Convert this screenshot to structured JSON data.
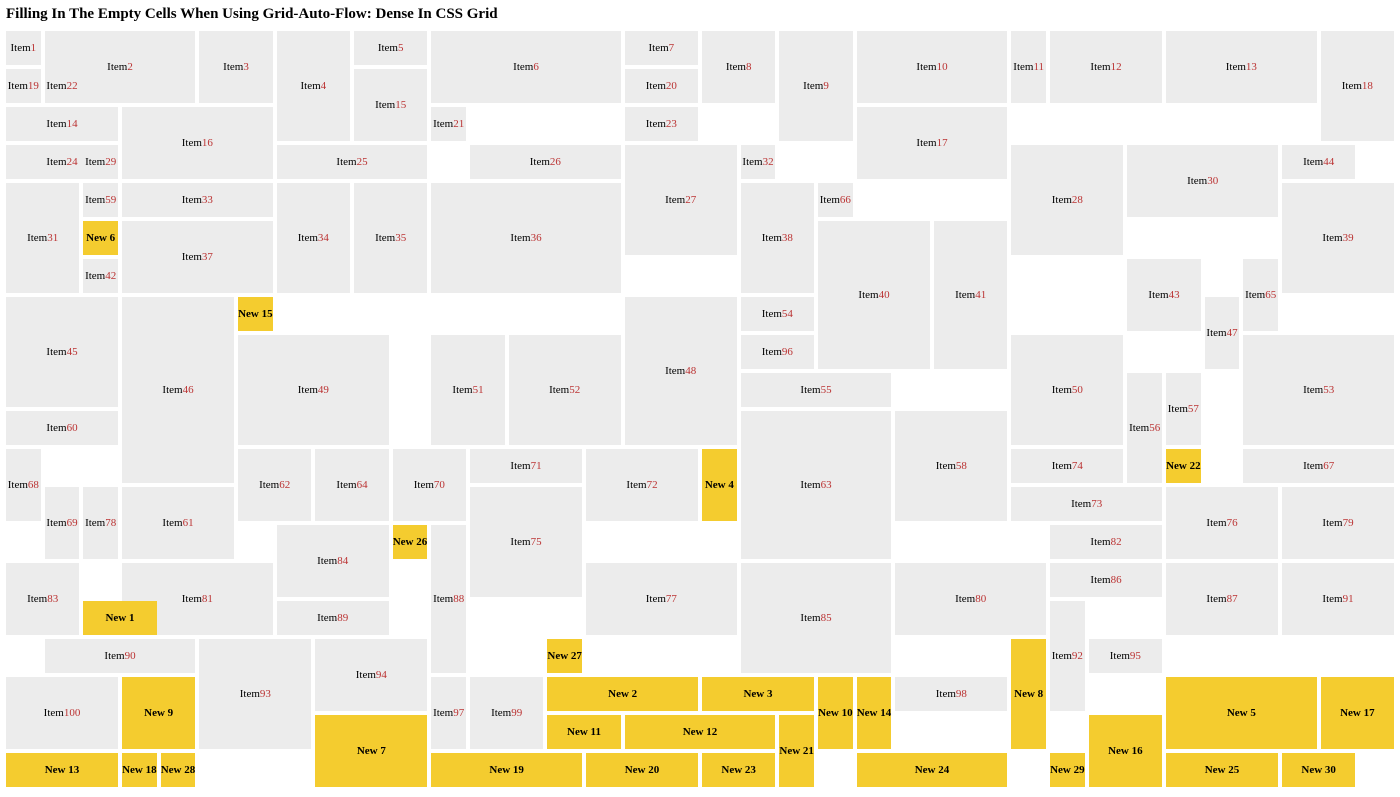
{
  "title": "Filling In The Empty Cells When Using Grid-Auto-Flow: Dense In CSS Grid",
  "base_prefix": "Item ",
  "new_prefix": "New ",
  "base_items": [
    {
      "label": "Item 1",
      "c": 1,
      "r": 1,
      "cs": 1,
      "rs": 1
    },
    {
      "label": "Item 2",
      "c": 2,
      "r": 1,
      "cs": 4,
      "rs": 2
    },
    {
      "label": "Item 3",
      "c": 6,
      "r": 1,
      "cs": 2,
      "rs": 2
    },
    {
      "label": "Item 4",
      "c": 8,
      "r": 1,
      "cs": 2,
      "rs": 3
    },
    {
      "label": "Item 5",
      "c": 10,
      "r": 1,
      "cs": 2,
      "rs": 1
    },
    {
      "label": "Item 6",
      "c": 12,
      "r": 1,
      "cs": 5,
      "rs": 2
    },
    {
      "label": "Item 7",
      "c": 17,
      "r": 1,
      "cs": 2,
      "rs": 1
    },
    {
      "label": "Item 8",
      "c": 19,
      "r": 1,
      "cs": 2,
      "rs": 2
    },
    {
      "label": "Item 9",
      "c": 21,
      "r": 1,
      "cs": 2,
      "rs": 3
    },
    {
      "label": "Item 10",
      "c": 23,
      "r": 1,
      "cs": 4,
      "rs": 2
    },
    {
      "label": "Item 11",
      "c": 27,
      "r": 1,
      "cs": 1,
      "rs": 2
    },
    {
      "label": "Item 12",
      "c": 28,
      "r": 1,
      "cs": 3,
      "rs": 2
    },
    {
      "label": "Item 13",
      "c": 31,
      "r": 1,
      "cs": 4,
      "rs": 2
    },
    {
      "label": "Item 18",
      "c": 35,
      "r": 1,
      "cs": 2,
      "rs": 3
    },
    {
      "label": "Item 19",
      "c": 1,
      "r": 2,
      "cs": 1,
      "rs": 1
    },
    {
      "label": "Item 14",
      "c": 1,
      "r": 3,
      "cs": 3,
      "rs": 1
    },
    {
      "label": "Item 16",
      "c": 4,
      "r": 3,
      "cs": 4,
      "rs": 2
    },
    {
      "label": "Item 15",
      "c": 10,
      "r": 2,
      "cs": 2,
      "rs": 2
    },
    {
      "label": "Item 21",
      "c": 12,
      "r": 3,
      "cs": 1,
      "rs": 1
    },
    {
      "label": "Item 20",
      "c": 17,
      "r": 2,
      "cs": 2,
      "rs": 1
    },
    {
      "label": "Item 23",
      "c": 17,
      "r": 3,
      "cs": 2,
      "rs": 1
    },
    {
      "label": "Item 17",
      "c": 23,
      "r": 3,
      "cs": 4,
      "rs": 2
    },
    {
      "label": "Item 24",
      "c": 1,
      "r": 4,
      "cs": 3,
      "rs": 1
    },
    {
      "label": "Item 25",
      "c": 8,
      "r": 4,
      "cs": 4,
      "rs": 1
    },
    {
      "label": "Item 26",
      "c": 13,
      "r": 4,
      "cs": 4,
      "rs": 1
    },
    {
      "label": "Item 27",
      "c": 17,
      "r": 4,
      "cs": 3,
      "rs": 3
    },
    {
      "label": "Item 32",
      "c": 20,
      "r": 4,
      "cs": 1,
      "rs": 1
    },
    {
      "label": "Item 28",
      "c": 27,
      "r": 4,
      "cs": 3,
      "rs": 3
    },
    {
      "label": "Item 30",
      "c": 30,
      "r": 4,
      "cs": 4,
      "rs": 2
    },
    {
      "label": "Item 44",
      "c": 34,
      "r": 4,
      "cs": 2,
      "rs": 1
    },
    {
      "label": "Item 31",
      "c": 1,
      "r": 5,
      "cs": 2,
      "rs": 3
    },
    {
      "label": "Item 59",
      "c": 3,
      "r": 5,
      "cs": 1,
      "rs": 1
    },
    {
      "label": "Item 29",
      "c": 3,
      "r": 4,
      "cs": 1,
      "rs": 1
    },
    {
      "label": "Item 33",
      "c": 4,
      "r": 5,
      "cs": 4,
      "rs": 1
    },
    {
      "label": "Item 66",
      "c": 22,
      "r": 5,
      "cs": 1,
      "rs": 1
    },
    {
      "label": "Item 37",
      "c": 4,
      "r": 6,
      "cs": 4,
      "rs": 2
    },
    {
      "label": "Item 34",
      "c": 8,
      "r": 5,
      "cs": 2,
      "rs": 3
    },
    {
      "label": "Item 35",
      "c": 10,
      "r": 5,
      "cs": 2,
      "rs": 3
    },
    {
      "label": "Item 36",
      "c": 12,
      "r": 5,
      "cs": 5,
      "rs": 3
    },
    {
      "label": "Item 38",
      "c": 20,
      "r": 5,
      "cs": 2,
      "rs": 3
    },
    {
      "label": "Item 40",
      "c": 22,
      "r": 6,
      "cs": 3,
      "rs": 4
    },
    {
      "label": "Item 41",
      "c": 25,
      "r": 6,
      "cs": 2,
      "rs": 4
    },
    {
      "label": "Item 39",
      "c": 34,
      "r": 5,
      "cs": 3,
      "rs": 3
    },
    {
      "label": "Item 42",
      "c": 3,
      "r": 7,
      "cs": 1,
      "rs": 1
    },
    {
      "label": "Item 43",
      "c": 30,
      "r": 7,
      "cs": 2,
      "rs": 2
    },
    {
      "label": "Item 65",
      "c": 33,
      "r": 7,
      "cs": 1,
      "rs": 2
    },
    {
      "label": "Item 47",
      "c": 32,
      "r": 8,
      "cs": 1,
      "rs": 2
    },
    {
      "label": "Item 45",
      "c": 1,
      "r": 8,
      "cs": 3,
      "rs": 3
    },
    {
      "label": "Item 46",
      "c": 4,
      "r": 8,
      "cs": 3,
      "rs": 5
    },
    {
      "label": "Item 49",
      "c": 7,
      "r": 9,
      "cs": 4,
      "rs": 3
    },
    {
      "label": "Item 51",
      "c": 12,
      "r": 9,
      "cs": 2,
      "rs": 3
    },
    {
      "label": "Item 48",
      "c": 17,
      "r": 8,
      "cs": 3,
      "rs": 4
    },
    {
      "label": "Item 54",
      "c": 20,
      "r": 8,
      "cs": 2,
      "rs": 1
    },
    {
      "label": "Item 96",
      "c": 20,
      "r": 9,
      "cs": 2,
      "rs": 1
    },
    {
      "label": "Item 52",
      "c": 14,
      "r": 9,
      "cs": 3,
      "rs": 3
    },
    {
      "label": "Item 50",
      "c": 27,
      "r": 9,
      "cs": 3,
      "rs": 3
    },
    {
      "label": "Item 55",
      "c": 20,
      "r": 10,
      "cs": 4,
      "rs": 1
    },
    {
      "label": "Item 57",
      "c": 31,
      "r": 10,
      "cs": 1,
      "rs": 2
    },
    {
      "label": "Item 53",
      "c": 33,
      "r": 9,
      "cs": 4,
      "rs": 3
    },
    {
      "label": "Item 56",
      "c": 30,
      "r": 10,
      "cs": 1,
      "rs": 3
    },
    {
      "label": "Item 60",
      "c": 1,
      "r": 11,
      "cs": 3,
      "rs": 1
    },
    {
      "label": "Item 58",
      "c": 24,
      "r": 11,
      "cs": 3,
      "rs": 3
    },
    {
      "label": "Item 63",
      "c": 20,
      "r": 11,
      "cs": 4,
      "rs": 4
    },
    {
      "label": "Item 67",
      "c": 33,
      "r": 12,
      "cs": 4,
      "rs": 1
    },
    {
      "label": "Item 68",
      "c": 1,
      "r": 12,
      "cs": 1,
      "rs": 2
    },
    {
      "label": "Item 61",
      "c": 4,
      "r": 13,
      "cs": 3,
      "rs": 2
    },
    {
      "label": "Item 62",
      "c": 7,
      "r": 12,
      "cs": 2,
      "rs": 2
    },
    {
      "label": "Item 64",
      "c": 9,
      "r": 12,
      "cs": 2,
      "rs": 2
    },
    {
      "label": "Item 70",
      "c": 11,
      "r": 12,
      "cs": 2,
      "rs": 2
    },
    {
      "label": "Item 69",
      "c": 2,
      "r": 13,
      "cs": 1,
      "rs": 2
    },
    {
      "label": "Item 71",
      "c": 13,
      "r": 12,
      "cs": 3,
      "rs": 1
    },
    {
      "label": "Item 72",
      "c": 16,
      "r": 12,
      "cs": 3,
      "rs": 2
    },
    {
      "label": "Item 74",
      "c": 27,
      "r": 12,
      "cs": 3,
      "rs": 1
    },
    {
      "label": "Item 73",
      "c": 27,
      "r": 13,
      "cs": 4,
      "rs": 1
    },
    {
      "label": "Item 78",
      "c": 3,
      "r": 13,
      "cs": 1,
      "rs": 2
    },
    {
      "label": "Item 76",
      "c": 31,
      "r": 13,
      "cs": 3,
      "rs": 2
    },
    {
      "label": "Item 79",
      "c": 34,
      "r": 13,
      "cs": 3,
      "rs": 2
    },
    {
      "label": "Item 75",
      "c": 13,
      "r": 13,
      "cs": 3,
      "rs": 3
    },
    {
      "label": "Item 77",
      "c": 16,
      "r": 15,
      "cs": 4,
      "rs": 2
    },
    {
      "label": "Item 82",
      "c": 28,
      "r": 14,
      "cs": 3,
      "rs": 1
    },
    {
      "label": "Item 83",
      "c": 1,
      "r": 15,
      "cs": 2,
      "rs": 2
    },
    {
      "label": "Item 81",
      "c": 4,
      "r": 15,
      "cs": 4,
      "rs": 2
    },
    {
      "label": "Item 84",
      "c": 8,
      "r": 14,
      "cs": 3,
      "rs": 2
    },
    {
      "label": "Item 88",
      "c": 12,
      "r": 14,
      "cs": 1,
      "rs": 4
    },
    {
      "label": "Item 80",
      "c": 24,
      "r": 15,
      "cs": 4,
      "rs": 2
    },
    {
      "label": "Item 86",
      "c": 28,
      "r": 15,
      "cs": 3,
      "rs": 1
    },
    {
      "label": "Item 87",
      "c": 31,
      "r": 15,
      "cs": 3,
      "rs": 2
    },
    {
      "label": "Item 91",
      "c": 34,
      "r": 15,
      "cs": 3,
      "rs": 2
    },
    {
      "label": "Item 89",
      "c": 8,
      "r": 16,
      "cs": 3,
      "rs": 1
    },
    {
      "label": "Item 85",
      "c": 20,
      "r": 15,
      "cs": 4,
      "rs": 3
    },
    {
      "label": "Item 92",
      "c": 28,
      "r": 16,
      "cs": 1,
      "rs": 3
    },
    {
      "label": "Item 95",
      "c": 29,
      "r": 17,
      "cs": 2,
      "rs": 1
    },
    {
      "label": "Item 90",
      "c": 2,
      "r": 17,
      "cs": 4,
      "rs": 1
    },
    {
      "label": "Item 93",
      "c": 6,
      "r": 17,
      "cs": 3,
      "rs": 3
    },
    {
      "label": "Item 94",
      "c": 9,
      "r": 17,
      "cs": 3,
      "rs": 2
    },
    {
      "label": "Item 98",
      "c": 24,
      "r": 18,
      "cs": 3,
      "rs": 1
    },
    {
      "label": "Item 99",
      "c": 13,
      "r": 18,
      "cs": 2,
      "rs": 2
    },
    {
      "label": "Item 97",
      "c": 12,
      "r": 18,
      "cs": 1,
      "rs": 2
    },
    {
      "label": "Item 100",
      "c": 1,
      "r": 18,
      "cs": 3,
      "rs": 2
    },
    {
      "label": "Item 22",
      "c": 2,
      "r": 2,
      "cs": 1,
      "rs": 1
    }
  ],
  "new_items": [
    {
      "label": "New 6",
      "c": 3,
      "r": 6,
      "cs": 1,
      "rs": 1
    },
    {
      "label": "New 15",
      "c": 7,
      "r": 8,
      "cs": 1,
      "rs": 1
    },
    {
      "label": "New 4",
      "c": 19,
      "r": 12,
      "cs": 1,
      "rs": 2
    },
    {
      "label": "New 22",
      "c": 31,
      "r": 12,
      "cs": 1,
      "rs": 1
    },
    {
      "label": "New 26",
      "c": 11,
      "r": 14,
      "cs": 1,
      "rs": 1
    },
    {
      "label": "New 1",
      "c": 3,
      "r": 16,
      "cs": 2,
      "rs": 1
    },
    {
      "label": "New 9",
      "c": 4,
      "r": 18,
      "cs": 2,
      "rs": 2
    },
    {
      "label": "New 27",
      "c": 15,
      "r": 17,
      "cs": 1,
      "rs": 1
    },
    {
      "label": "New 2",
      "c": 15,
      "r": 18,
      "cs": 4,
      "rs": 1
    },
    {
      "label": "New 3",
      "c": 19,
      "r": 18,
      "cs": 3,
      "rs": 1
    },
    {
      "label": "New 11",
      "c": 15,
      "r": 19,
      "cs": 2,
      "rs": 1
    },
    {
      "label": "New 12",
      "c": 17,
      "r": 19,
      "cs": 4,
      "rs": 1
    },
    {
      "label": "New 21",
      "c": 21,
      "r": 19,
      "cs": 1,
      "rs": 2
    },
    {
      "label": "New 10",
      "c": 22,
      "r": 18,
      "cs": 1,
      "rs": 2
    },
    {
      "label": "New 14",
      "c": 23,
      "r": 18,
      "cs": 1,
      "rs": 2
    },
    {
      "label": "New 8",
      "c": 27,
      "r": 17,
      "cs": 1,
      "rs": 3
    },
    {
      "label": "New 5",
      "c": 31,
      "r": 18,
      "cs": 4,
      "rs": 2
    },
    {
      "label": "New 17",
      "c": 35,
      "r": 18,
      "cs": 2,
      "rs": 2
    },
    {
      "label": "New 16",
      "c": 29,
      "r": 19,
      "cs": 2,
      "rs": 2
    },
    {
      "label": "New 7",
      "c": 9,
      "r": 19,
      "cs": 3,
      "rs": 2
    },
    {
      "label": "New 13",
      "c": 1,
      "r": 20,
      "cs": 3,
      "rs": 1
    },
    {
      "label": "New 18",
      "c": 4,
      "r": 20,
      "cs": 1,
      "rs": 1
    },
    {
      "label": "New 28",
      "c": 5,
      "r": 20,
      "cs": 1,
      "rs": 1
    },
    {
      "label": "New 19",
      "c": 12,
      "r": 20,
      "cs": 4,
      "rs": 1
    },
    {
      "label": "New 20",
      "c": 16,
      "r": 20,
      "cs": 3,
      "rs": 1
    },
    {
      "label": "New 23",
      "c": 19,
      "r": 20,
      "cs": 2,
      "rs": 1
    },
    {
      "label": "New 24",
      "c": 23,
      "r": 20,
      "cs": 4,
      "rs": 1
    },
    {
      "label": "New 29",
      "c": 28,
      "r": 20,
      "cs": 1,
      "rs": 1
    },
    {
      "label": "New 25",
      "c": 31,
      "r": 20,
      "cs": 3,
      "rs": 1
    },
    {
      "label": "New 30",
      "c": 34,
      "r": 20,
      "cs": 2,
      "rs": 1
    }
  ]
}
